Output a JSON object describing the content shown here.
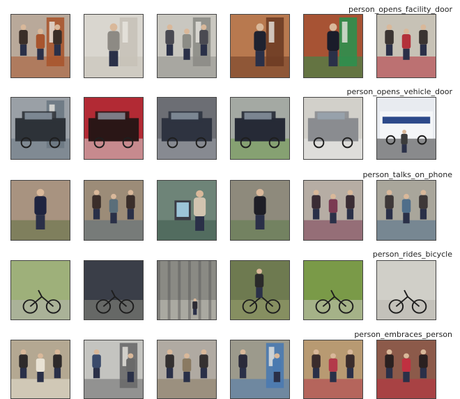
{
  "rows": [
    {
      "label": "person_opens_facility_door",
      "thumbs": [
        {
          "bg": "#b9a99a",
          "fg": "#3a2e28",
          "accent": "#a8552e",
          "subject": "people-in-doorway"
        },
        {
          "bg": "#d9d6cf",
          "fg": "#8d8a84",
          "accent": "#c7c2b8",
          "subject": "open-door"
        },
        {
          "bg": "#c9c7c0",
          "fg": "#4a4a52",
          "accent": "#8c8c86",
          "subject": "people-at-door"
        },
        {
          "bg": "#b8794f",
          "fg": "#1f2230",
          "accent": "#6e3c24",
          "subject": "person-at-door"
        },
        {
          "bg": "#a75334",
          "fg": "#1a1c2a",
          "accent": "#2e8f4e",
          "subject": "person-at-door"
        },
        {
          "bg": "#c7c2b6",
          "fg": "#3a3432",
          "accent": "#b3303a",
          "subject": "lobby-people"
        }
      ]
    },
    {
      "label": "person_opens_vehicle_door",
      "thumbs": [
        {
          "bg": "#9aa0a6",
          "fg": "#2d3238",
          "accent": "#6c7883",
          "subject": "car-door"
        },
        {
          "bg": "#b22a34",
          "fg": "#2a1616",
          "accent": "#d8d8d8",
          "subject": "red-car"
        },
        {
          "bg": "#6c6e74",
          "fg": "#2e3340",
          "accent": "#9ea2aa",
          "subject": "minivan"
        },
        {
          "bg": "#a4a9a3",
          "fg": "#262a36",
          "accent": "#6e9a4a",
          "subject": "minivan"
        },
        {
          "bg": "#d2d0ca",
          "fg": "#8a8c90",
          "accent": "#e8e8e8",
          "subject": "white-van"
        },
        {
          "bg": "#e8ebf0",
          "fg": "#2d4a8a",
          "accent": "#3b3b3b",
          "subject": "bus"
        }
      ]
    },
    {
      "label": "person_talks_on_phone",
      "thumbs": [
        {
          "bg": "#a89380",
          "fg": "#1f2440",
          "accent": "#5d7040",
          "subject": "sitting-person"
        },
        {
          "bg": "#9c8c78",
          "fg": "#3a2e2a",
          "accent": "#5a6e7a",
          "subject": "room-people"
        },
        {
          "bg": "#6e8478",
          "fg": "#d2c4b0",
          "accent": "#3c5a4a",
          "subject": "phone-hand"
        },
        {
          "bg": "#8e8a7c",
          "fg": "#1e1e26",
          "accent": "#5c7c4a",
          "subject": "person-standing"
        },
        {
          "bg": "#b6ada4",
          "fg": "#3a2c34",
          "accent": "#7a3a52",
          "subject": "cafe-people"
        },
        {
          "bg": "#a9a69b",
          "fg": "#3e3838",
          "accent": "#4f6e8a",
          "subject": "cafe-people"
        }
      ]
    },
    {
      "label": "person_rides_bicycle",
      "thumbs": [
        {
          "bg": "#9eb07a",
          "fg": "#2a2e3c",
          "accent": "#b4b4b0",
          "subject": "bike-path"
        },
        {
          "bg": "#3a3e48",
          "fg": "#5a7ab2",
          "accent": "#8a8a80",
          "subject": "bike-rack"
        },
        {
          "bg": "#8a8a84",
          "fg": "#2c2c34",
          "accent": "#c4c2ba",
          "subject": "shadows"
        },
        {
          "bg": "#6e7a50",
          "fg": "#2a2a2a",
          "accent": "#9aa070",
          "subject": "cyclist"
        },
        {
          "bg": "#7a9a48",
          "fg": "#2a2a2a",
          "accent": "#c8c6be",
          "subject": "bike-grass"
        },
        {
          "bg": "#d0cfc8",
          "fg": "#2a2a2a",
          "accent": "#b8b6ae",
          "subject": "bike-road"
        }
      ]
    },
    {
      "label": "person_embraces_person",
      "thumbs": [
        {
          "bg": "#b4a892",
          "fg": "#2e2a2a",
          "accent": "#e8e2d4",
          "subject": "two-people"
        },
        {
          "bg": "#c4c4c0",
          "fg": "#3a4a6a",
          "accent": "#6a6a6a",
          "subject": "hug-outdoor"
        },
        {
          "bg": "#b0aaa2",
          "fg": "#343030",
          "accent": "#8a7a62",
          "subject": "lobby-people"
        },
        {
          "bg": "#9c9a8c",
          "fg": "#2a2a3a",
          "accent": "#4a7ab0",
          "subject": "hug-outdoor"
        },
        {
          "bg": "#b89a72",
          "fg": "#3a2c2c",
          "accent": "#b33a4a",
          "subject": "hall-people"
        },
        {
          "bg": "#8c5a4a",
          "fg": "#2a2020",
          "accent": "#c03040",
          "subject": "crowd"
        }
      ]
    }
  ]
}
